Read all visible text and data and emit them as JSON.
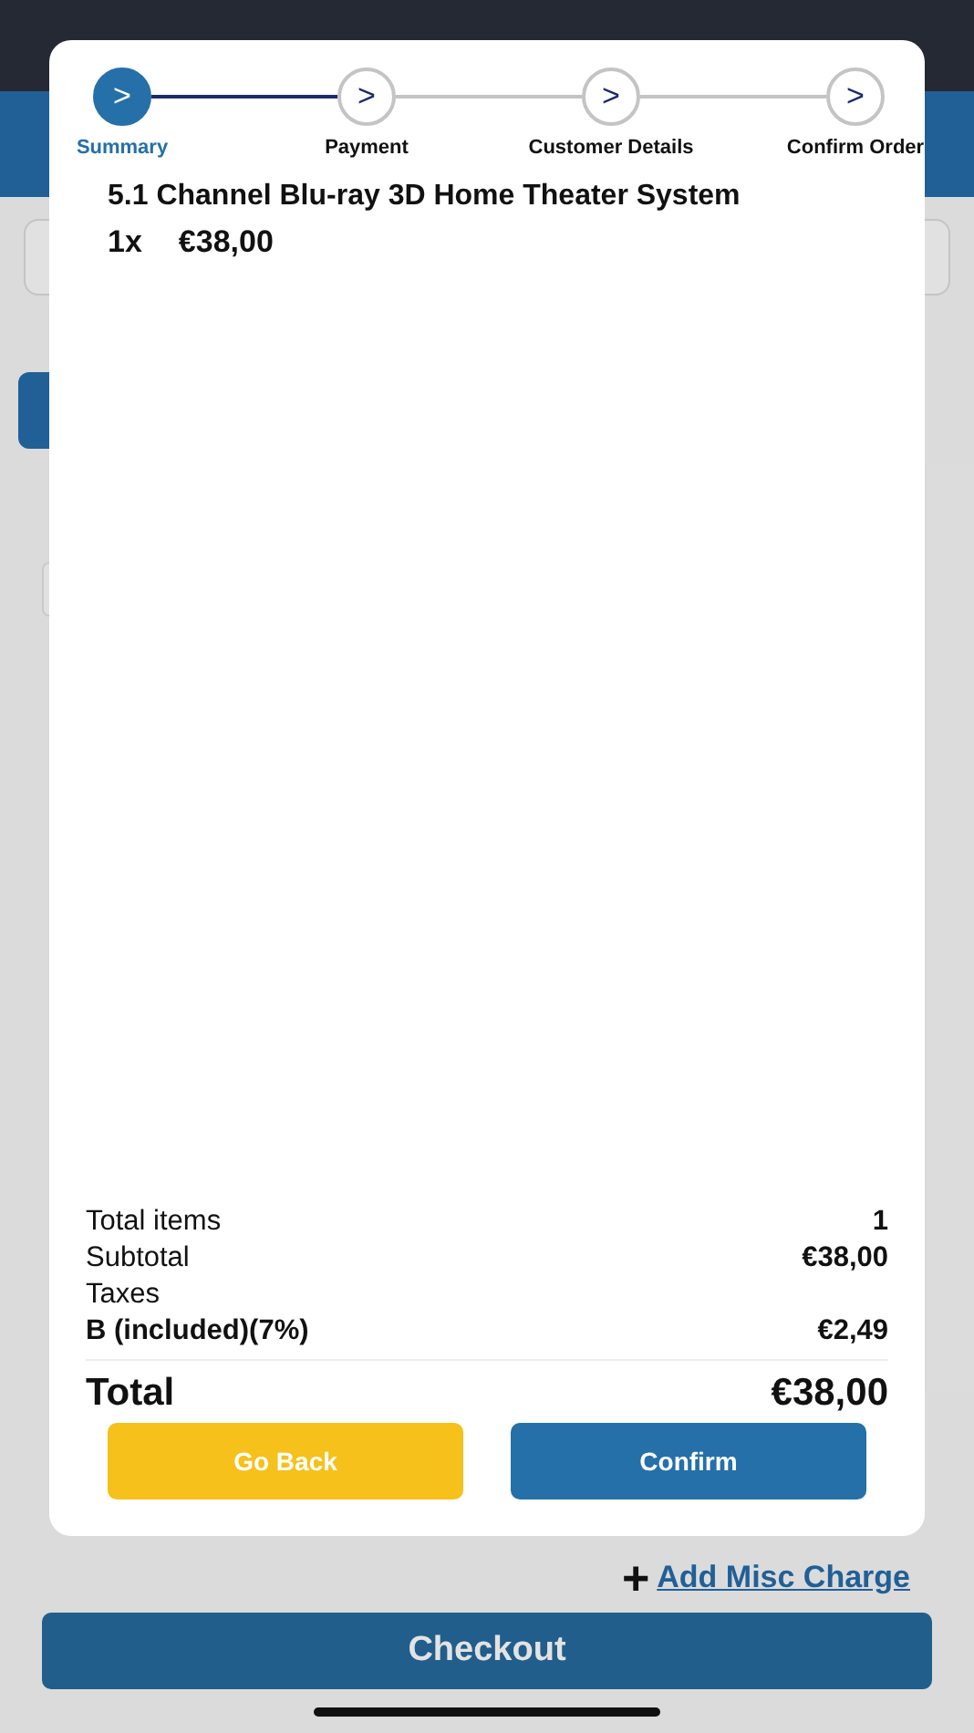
{
  "steps": [
    {
      "label": "Summary",
      "selected": true
    },
    {
      "label": "Payment",
      "selected": false
    },
    {
      "label": "Customer Details",
      "selected": false
    },
    {
      "label": "Confirm Order",
      "selected": false
    }
  ],
  "step_icon": ">",
  "item": {
    "name": "5.1 Channel Blu-ray 3D Home Theater System",
    "quantity": "1x",
    "price": "€38,00"
  },
  "summary": [
    {
      "kind": "line",
      "label": "Total items",
      "value": "1"
    },
    {
      "kind": "line",
      "label": "Subtotal",
      "value": "€38,00"
    },
    {
      "kind": "heading",
      "label": "Taxes"
    },
    {
      "kind": "tax",
      "label": "B (included)(7%)",
      "value": "€2,49"
    }
  ],
  "total": {
    "label": "Total",
    "value": "€38,00"
  },
  "buttons": {
    "back": "Go Back",
    "confirm": "Confirm"
  },
  "add_misc": {
    "icon": "+",
    "label": "Add Misc Charge"
  },
  "checkout": "Checkout"
}
